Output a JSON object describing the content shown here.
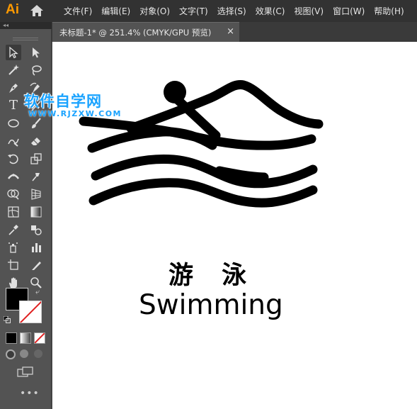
{
  "app": {
    "logo_text": "Ai"
  },
  "menu": {
    "items": [
      {
        "label": "文件(F)"
      },
      {
        "label": "编辑(E)"
      },
      {
        "label": "对象(O)"
      },
      {
        "label": "文字(T)"
      },
      {
        "label": "选择(S)"
      },
      {
        "label": "效果(C)"
      },
      {
        "label": "视图(V)"
      },
      {
        "label": "窗口(W)"
      },
      {
        "label": "帮助(H)"
      }
    ]
  },
  "panel": {
    "collapse_glyph": "◂◂"
  },
  "document_tab": {
    "label": "未标题-1* @ 251.4% (CMYK/GPU 预览)",
    "close_glyph": "×"
  },
  "toolbar": {
    "tools": [
      {
        "name": "selection-tool-icon"
      },
      {
        "name": "direct-selection-tool-icon"
      },
      {
        "name": "magic-wand-tool-icon"
      },
      {
        "name": "lasso-tool-icon"
      },
      {
        "name": "pen-tool-icon"
      },
      {
        "name": "curvature-tool-icon"
      },
      {
        "name": "type-tool-icon",
        "glyph": "T"
      },
      {
        "name": "line-segment-tool-icon"
      },
      {
        "name": "ellipse-tool-icon"
      },
      {
        "name": "paintbrush-tool-icon"
      },
      {
        "name": "shaper-tool-icon"
      },
      {
        "name": "eraser-tool-icon"
      },
      {
        "name": "rotate-tool-icon"
      },
      {
        "name": "scale-tool-icon"
      },
      {
        "name": "width-tool-icon"
      },
      {
        "name": "puppet-warp-tool-icon"
      },
      {
        "name": "shape-builder-tool-icon"
      },
      {
        "name": "perspective-grid-tool-icon"
      },
      {
        "name": "mesh-tool-icon"
      },
      {
        "name": "gradient-tool-icon"
      },
      {
        "name": "eyedropper-tool-icon"
      },
      {
        "name": "blend-tool-icon"
      },
      {
        "name": "symbol-sprayer-tool-icon"
      },
      {
        "name": "column-graph-tool-icon"
      },
      {
        "name": "artboard-tool-icon"
      },
      {
        "name": "slice-tool-icon"
      },
      {
        "name": "hand-tool-icon"
      },
      {
        "name": "zoom-tool-icon"
      }
    ],
    "more_glyph": "•••"
  },
  "colors": {
    "fill": "#000000",
    "stroke": "#ffffff",
    "ai_orange": "#ff9a00",
    "watermark_blue": "#1aa3ff"
  },
  "watermark": {
    "title": "软件自学网",
    "url": "WWW.RJZXW.COM"
  },
  "artwork": {
    "chinese_title": "游 泳",
    "english_title": "Swimming"
  }
}
